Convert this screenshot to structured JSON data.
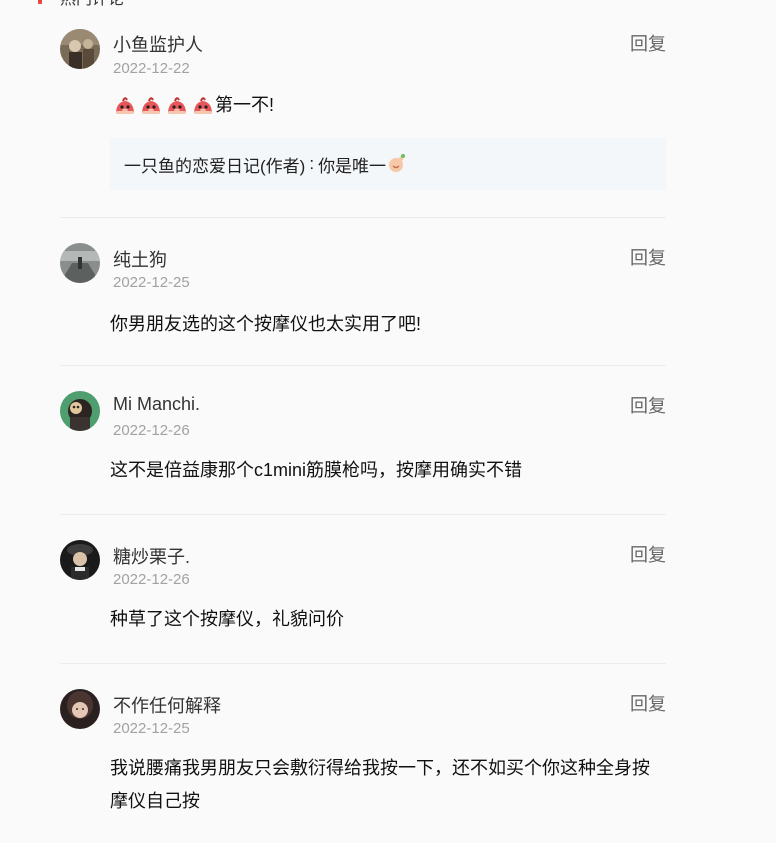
{
  "section": {
    "title": "热门评论"
  },
  "reply_label": "回复",
  "comments": [
    {
      "user": "小鱼监护人",
      "date": "2022-12-22",
      "text": "第一不!",
      "emoji": "red-bird-emoji",
      "emoji_count": 4,
      "author_reply": {
        "user": "一只鱼的恋爱日记(作者)",
        "separator": ":",
        "text": "你是唯一",
        "emoji": "finger-emoji"
      }
    },
    {
      "user": "纯土狗",
      "date": "2022-12-25",
      "text": "你男朋友选的这个按摩仪也太实用了吧!"
    },
    {
      "user": "Mi Manchi.",
      "date": "2022-12-26",
      "text": "这不是倍益康那个c1mini筋膜枪吗，按摩用确实不错"
    },
    {
      "user": "糖炒栗子.",
      "date": "2022-12-26",
      "text": "种草了这个按摩仪，礼貌问价"
    },
    {
      "user": "不作任何解释",
      "date": "2022-12-25",
      "text": "我说腰痛我男朋友只会敷衍得给我按一下，还不如买个你这种全身按摩仪自己按"
    }
  ],
  "colors": {
    "accent": "#e8463b",
    "date": "#a2a2a2",
    "reply_bg": "#f4f7fa",
    "divider": "#ececec"
  }
}
